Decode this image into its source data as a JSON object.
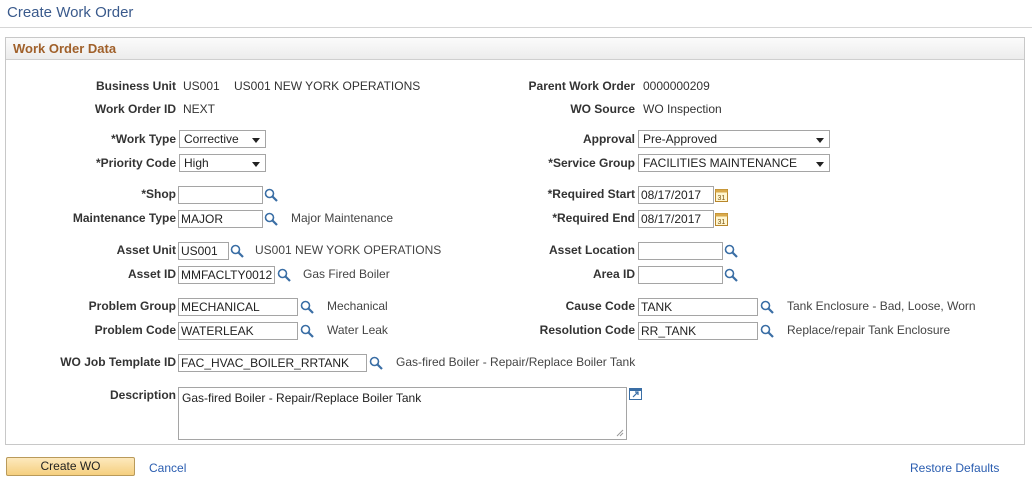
{
  "page": {
    "title": "Create Work Order"
  },
  "group": {
    "title": "Work Order Data"
  },
  "fields": {
    "business_unit": {
      "label": "Business Unit",
      "value": "US001",
      "description": "US001 NEW YORK OPERATIONS"
    },
    "work_order_id": {
      "label": "Work Order ID",
      "value": "NEXT"
    },
    "parent_work_order": {
      "label": "Parent Work Order",
      "value": "0000000209"
    },
    "wo_source": {
      "label": "WO Source",
      "value": "WO Inspection"
    },
    "work_type": {
      "label": "*Work Type",
      "value": "Corrective"
    },
    "priority_code": {
      "label": "*Priority Code",
      "value": "High"
    },
    "approval": {
      "label": "Approval",
      "value": "Pre-Approved"
    },
    "service_group": {
      "label": "*Service Group",
      "value": "FACILITIES MAINTENANCE"
    },
    "shop": {
      "label": "*Shop",
      "value": ""
    },
    "maintenance_type": {
      "label": "Maintenance Type",
      "value": "MAJOR",
      "description": "Major Maintenance"
    },
    "required_start": {
      "label": "*Required Start",
      "value": "08/17/2017"
    },
    "required_end": {
      "label": "*Required End",
      "value": "08/17/2017"
    },
    "asset_unit": {
      "label": "Asset Unit",
      "value": "US001",
      "description": "US001 NEW YORK OPERATIONS"
    },
    "asset_id": {
      "label": "Asset ID",
      "value": "MMFACLTY0012",
      "description": "Gas Fired Boiler"
    },
    "asset_location": {
      "label": "Asset Location",
      "value": ""
    },
    "area_id": {
      "label": "Area ID",
      "value": ""
    },
    "problem_group": {
      "label": "Problem Group",
      "value": "MECHANICAL",
      "description": "Mechanical"
    },
    "problem_code": {
      "label": "Problem Code",
      "value": "WATERLEAK",
      "description": "Water Leak"
    },
    "cause_code": {
      "label": "Cause Code",
      "value": "TANK",
      "description": "Tank Enclosure - Bad, Loose, Worn"
    },
    "resolution_code": {
      "label": "Resolution Code",
      "value": "RR_TANK",
      "description": "Replace/repair Tank Enclosure"
    },
    "wo_job_template_id": {
      "label": "WO Job Template ID",
      "value": "FAC_HVAC_BOILER_RRTANK",
      "description": "Gas-fired Boiler - Repair/Replace Boiler Tank"
    },
    "description": {
      "label": "Description",
      "value": "Gas-fired Boiler - Repair/Replace Boiler Tank"
    }
  },
  "actions": {
    "create_wo": "Create WO",
    "cancel": "Cancel",
    "restore_defaults": "Restore Defaults"
  },
  "icons": {
    "lookup": "magnifier-icon",
    "calendar": "calendar-icon",
    "expand": "expand-icon"
  },
  "colors": {
    "title": "#3a5a8c",
    "group_title": "#a0602a",
    "link": "#2a5db0",
    "button": "#f5cf7f"
  }
}
